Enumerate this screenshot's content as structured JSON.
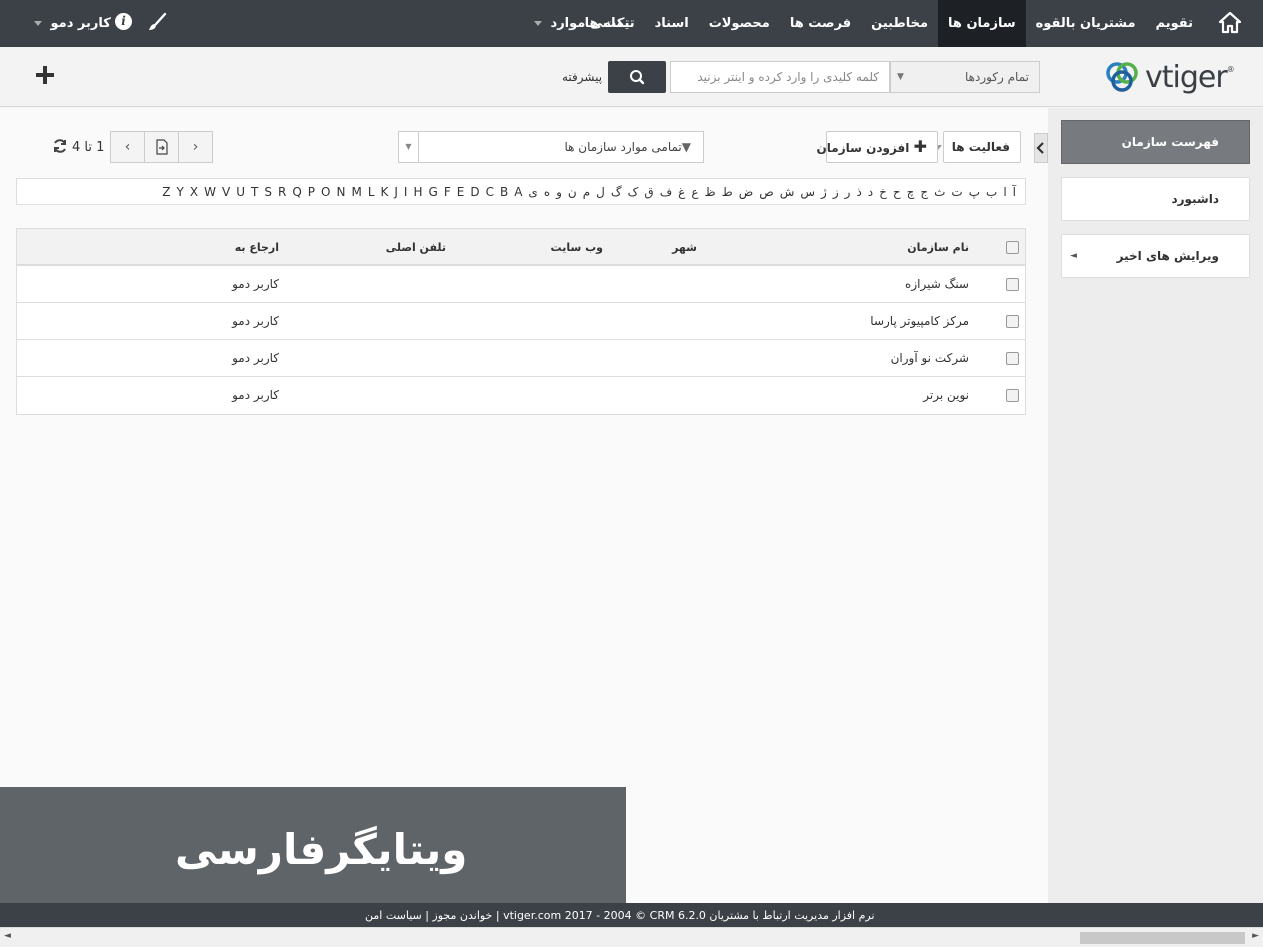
{
  "topnav": {
    "menu": [
      "تقویم",
      "مشتریان بالقوه",
      "سازمان ها",
      "مخاطبین",
      "فرصت ها",
      "محصولات",
      "اسناد",
      "تیکت ها"
    ],
    "active_index": 2,
    "all_items": "تمامی موارد",
    "user": "کاربر دمو",
    "info": "i"
  },
  "header": {
    "logo_text": "vtiger",
    "logo_mark": "®",
    "record_select": "تمام رکوردها",
    "search_placeholder": "کلمه کلیدی را وارد کرده و اینتر بزنید",
    "advanced": "پیشرفته"
  },
  "sidebar": {
    "items": [
      "فهرست سازمان",
      "داشبورد",
      "ویرایش های اخیر"
    ]
  },
  "toolbar": {
    "activities_label": "فعالیت ها",
    "add_org_label": "افزودن سازمان",
    "filter_label": "تمامی موارد سازمان ها",
    "page_count": "1 تا 4"
  },
  "alphabet": [
    "آ",
    "ا",
    "ب",
    "پ",
    "ت",
    "ث",
    "ج",
    "چ",
    "ح",
    "خ",
    "د",
    "ذ",
    "ر",
    "ز",
    "ژ",
    "س",
    "ش",
    "ص",
    "ض",
    "ط",
    "ظ",
    "ع",
    "غ",
    "ف",
    "ق",
    "ک",
    "گ",
    "ل",
    "م",
    "ن",
    "و",
    "ه",
    "ی",
    "A",
    "B",
    "C",
    "D",
    "E",
    "F",
    "G",
    "H",
    "I",
    "J",
    "K",
    "L",
    "M",
    "N",
    "O",
    "P",
    "Q",
    "R",
    "S",
    "T",
    "U",
    "V",
    "W",
    "X",
    "Y",
    "Z"
  ],
  "table": {
    "headers": {
      "name": "نام سازمان",
      "city": "شهر",
      "website": "وب سایت",
      "phone": "تلفن اصلی",
      "assigned": "ارجاع به"
    },
    "rows": [
      {
        "name": "سنگ شیرازه",
        "assigned": "کاربر دمو"
      },
      {
        "name": "مرکز کامپیوتر پارسا",
        "assigned": "کاربر دمو"
      },
      {
        "name": "شرکت نو آوران",
        "assigned": "کاربر دمو"
      },
      {
        "name": "نوین برتر",
        "assigned": "کاربر دمو"
      }
    ]
  },
  "watermark": "ویتایگرفارسی",
  "footer": "نرم افزار مدیریت ارتباط با مشتریان vtiger.com 2017 - 2004 © CRM 6.2.0 | خواندن مجوز | سیاست امن",
  "colors": {
    "nav_bg": "#3c4148",
    "active_nav": "#1d2024",
    "logo_blue": "#2a7fc1",
    "logo_green": "#56b048"
  }
}
